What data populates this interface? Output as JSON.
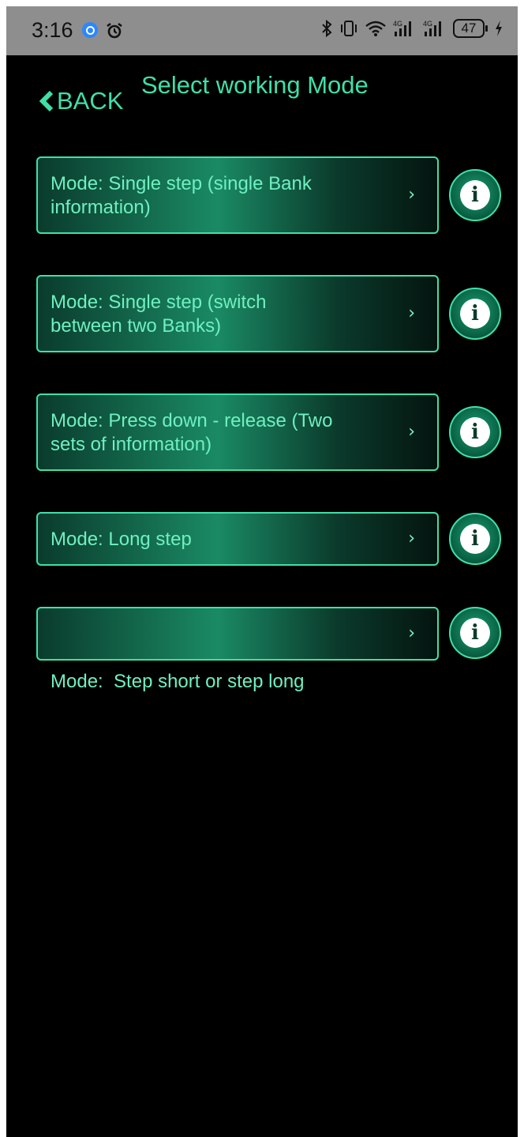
{
  "status_bar": {
    "time": "3:16",
    "battery": "47",
    "icons": [
      "search-badge-icon",
      "alarm-icon",
      "bluetooth-icon",
      "vibrate-icon",
      "wifi-icon",
      "signal-4g-icon",
      "signal-4g-icon",
      "battery-icon",
      "charging-icon"
    ]
  },
  "header": {
    "back_label": "BACK",
    "title": "Select working Mode"
  },
  "modes": [
    {
      "label_line1": "Mode: Single step (single Bank",
      "label_line2": "information)"
    },
    {
      "label_line1": "Mode: Single step (switch",
      "label_line2": "between two Banks)"
    },
    {
      "label_line1": "Mode: Press down - release (Two",
      "label_line2": "sets of information)"
    },
    {
      "label_line1": "Mode: Long step",
      "label_line2": ""
    },
    {
      "label_line1": "Mode:  Step short or step long",
      "label_line2": ""
    }
  ],
  "chevron": "›",
  "info_glyph": "i",
  "colors": {
    "accent": "#3fe0a8",
    "background": "#000000",
    "status_bar": "#8e8e8e"
  }
}
